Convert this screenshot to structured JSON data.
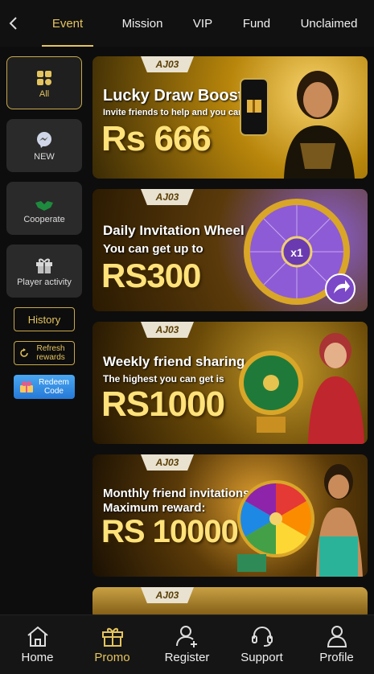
{
  "topnav": {
    "tabs": [
      {
        "label": "Event",
        "active": true
      },
      {
        "label": "Mission",
        "active": false
      },
      {
        "label": "VIP",
        "active": false
      },
      {
        "label": "Fund",
        "active": false
      },
      {
        "label": "Unclaimed",
        "active": false
      }
    ]
  },
  "sidebar": {
    "items": [
      {
        "label": "All",
        "icon": "grid-icon",
        "active": true
      },
      {
        "label": "NEW",
        "icon": "messenger-icon",
        "active": false
      },
      {
        "label": "Cooperate",
        "icon": "handshake-icon",
        "active": false
      },
      {
        "label": "Player activity",
        "icon": "gift-icon",
        "active": false
      }
    ],
    "history_label": "History",
    "refresh_label": "Refresh rewards",
    "redeem_label": "Redeem Code"
  },
  "banners": [
    {
      "logo": "AJ03",
      "title": "Lucky Draw Boost",
      "subtitle": "Invite friends to help and you can get",
      "amount": "Rs 666"
    },
    {
      "logo": "AJ03",
      "title": "Daily Invitation Wheel",
      "subtitle": "You can get up to",
      "amount": "RS300",
      "wheel_center": "x1"
    },
    {
      "logo": "AJ03",
      "title": "Weekly friend sharing",
      "subtitle": "The highest you can get is",
      "amount": "RS1000"
    },
    {
      "logo": "AJ03",
      "title": "Monthly friend invitations",
      "subtitle": "Maximum reward:",
      "amount": "RS 10000"
    },
    {
      "logo": "AJ03"
    }
  ],
  "bottomnav": [
    {
      "label": "Home",
      "icon": "home-icon",
      "active": false
    },
    {
      "label": "Promo",
      "icon": "gift-icon",
      "active": true
    },
    {
      "label": "Register",
      "icon": "user-plus-icon",
      "active": false
    },
    {
      "label": "Support",
      "icon": "headset-icon",
      "active": false
    },
    {
      "label": "Profile",
      "icon": "user-icon",
      "active": false
    }
  ],
  "colors": {
    "accent": "#e4c45e",
    "background": "#0d0d0d"
  }
}
